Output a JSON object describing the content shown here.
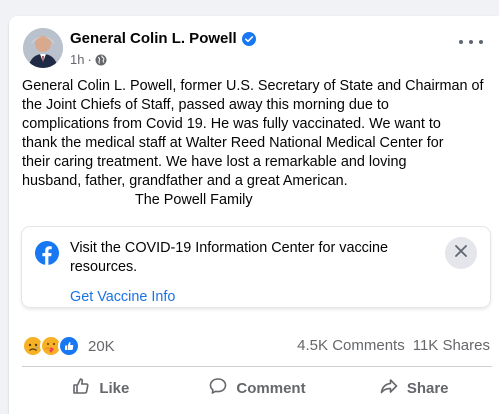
{
  "post": {
    "author": "General Colin L. Powell",
    "timestamp": "1h",
    "audience_icon": "globe-icon",
    "more_icon": "more-options-icon",
    "text_lines": [
      "General Colin L. Powell, former U.S. Secretary of State and Chairman of",
      "the Joint Chiefs of Staff, passed away this morning due to",
      "complications from Covid 19.  He was fully vaccinated.  We want to",
      "thank the medical staff at Walter Reed National Medical Center for",
      "their caring treatment.  We have lost a remarkable and loving",
      "husband, father, grandfather and a great American."
    ],
    "signature": "The Powell Family"
  },
  "covid_info": {
    "text": "Visit the COVID-19 Information Center for vaccine resources.",
    "link": "Get Vaccine Info"
  },
  "engagement": {
    "reaction_icons": [
      "sad-reaction-icon",
      "care-reaction-icon",
      "like-reaction-icon"
    ],
    "reaction_count": "20K",
    "comments": "4.5K Comments",
    "shares": "11K Shares"
  },
  "actions": {
    "like": "Like",
    "comment": "Comment",
    "share": "Share"
  },
  "colors": {
    "facebook_blue": "#1877f2",
    "link_blue": "#1b74e4",
    "secondary_text": "#65676b",
    "background": "#f0f2f5"
  }
}
